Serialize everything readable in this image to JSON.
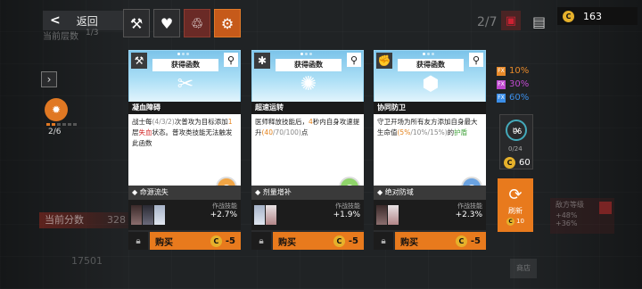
{
  "header": {
    "back_label": "返回",
    "layer_label": "当前层数",
    "layer_count": "1/3",
    "page_indicator": "2/7",
    "coins": "163"
  },
  "left": {
    "stage": "2/6",
    "score_label": "当前分数",
    "score_value": "328",
    "score_secondary": "17501"
  },
  "cards": [
    {
      "tag": "获得函数",
      "name": "凝血障碍",
      "desc": [
        {
          "t": "战士每"
        },
        {
          "t": "(4/3/2)",
          "c": "gray"
        },
        {
          "t": "次普攻为目标添加"
        },
        {
          "t": "1",
          "c": "o"
        },
        {
          "t": "层"
        },
        {
          "t": "失血",
          "c": "r"
        },
        {
          "t": "状态。普攻类技能无法触发此函数"
        }
      ],
      "source": "命源流失",
      "bonus_label": "作战技能",
      "bonus_value": "+2.7%",
      "buy_label": "购买",
      "price": "-5",
      "icon": "hammer-icon",
      "art": "blood-drop-icon"
    },
    {
      "tag": "获得函数",
      "name": "超速运转",
      "desc": [
        {
          "t": "医师释放技能后，"
        },
        {
          "t": "4",
          "c": "o"
        },
        {
          "t": "秒内自身攻速提升"
        },
        {
          "t": "(40",
          "c": "o"
        },
        {
          "t": "/70/100)",
          "c": "gray"
        },
        {
          "t": "点"
        }
      ],
      "source": "剂量增补",
      "bonus_label": "作战技能",
      "bonus_value": "+1.9%",
      "buy_label": "购买",
      "price": "-5",
      "icon": "asterisk-icon",
      "art": "gear-spark-icon"
    },
    {
      "tag": "获得函数",
      "name": "协同防卫",
      "desc": [
        {
          "t": "守卫开场为所有友方添加自身最大生命值"
        },
        {
          "t": "(5%",
          "c": "o"
        },
        {
          "t": "/10%/15%)",
          "c": "gray"
        },
        {
          "t": "的"
        },
        {
          "t": "护盾",
          "c": "g"
        }
      ],
      "source": "绝对防域",
      "bonus_label": "作战技能",
      "bonus_value": "+2.3%",
      "buy_label": "购买",
      "price": "-5",
      "icon": "fist-icon",
      "art": "hexagon-shield-icon"
    }
  ],
  "right": {
    "fx": [
      {
        "tag": "FX",
        "value": "10%",
        "color": "#e88a2a"
      },
      {
        "tag": "FX",
        "value": "30%",
        "color": "#c04ad0"
      },
      {
        "tag": "FX",
        "value": "60%",
        "color": "#3b8ee8"
      }
    ],
    "level": "LV",
    "level_num": "06",
    "xp": "0/24",
    "coins": "60",
    "refresh_label": "刷新",
    "refresh_cost": "10",
    "enemy_label": "敌方等级",
    "enemy_a": "+48%",
    "enemy_b": "+36%",
    "shop_label": "商店"
  }
}
